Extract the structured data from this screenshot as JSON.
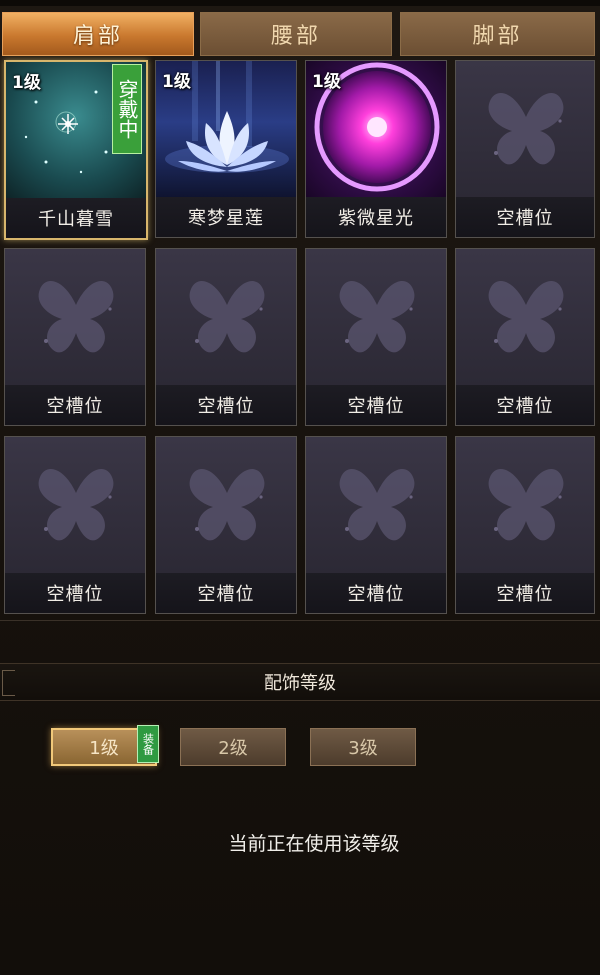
{
  "tabs": [
    {
      "label": "肩部",
      "active": true
    },
    {
      "label": "腰部",
      "active": false
    },
    {
      "label": "脚部",
      "active": false
    }
  ],
  "items": [
    {
      "name": "千山暮雪",
      "level": "1级",
      "badge": "穿戴中",
      "art": "snow-tree-art",
      "selected": true
    },
    {
      "name": "寒梦星莲",
      "level": "1级",
      "art": "lotus-art"
    },
    {
      "name": "紫微星光",
      "level": "1级",
      "art": "purple-orb-art"
    },
    {
      "name": "空槽位",
      "art": "butterfly-icon"
    },
    {
      "name": "空槽位",
      "art": "butterfly-icon"
    },
    {
      "name": "空槽位",
      "art": "butterfly-icon"
    },
    {
      "name": "空槽位",
      "art": "butterfly-icon"
    },
    {
      "name": "空槽位",
      "art": "butterfly-icon"
    },
    {
      "name": "空槽位",
      "art": "butterfly-icon"
    },
    {
      "name": "空槽位",
      "art": "butterfly-icon"
    },
    {
      "name": "空槽位",
      "art": "butterfly-icon"
    },
    {
      "name": "空槽位",
      "art": "butterfly-icon"
    }
  ],
  "accessory_level": {
    "title": "配饰等级",
    "levels": [
      {
        "label": "1级",
        "active": true,
        "tag": "装备"
      },
      {
        "label": "2级",
        "active": false
      },
      {
        "label": "3级",
        "active": false
      }
    ],
    "status_text": "当前正在使用该等级"
  },
  "colors": {
    "active_tab": "#d68a3c",
    "badge_green": "#3aa03a",
    "selected_border": "#d8b66c"
  }
}
